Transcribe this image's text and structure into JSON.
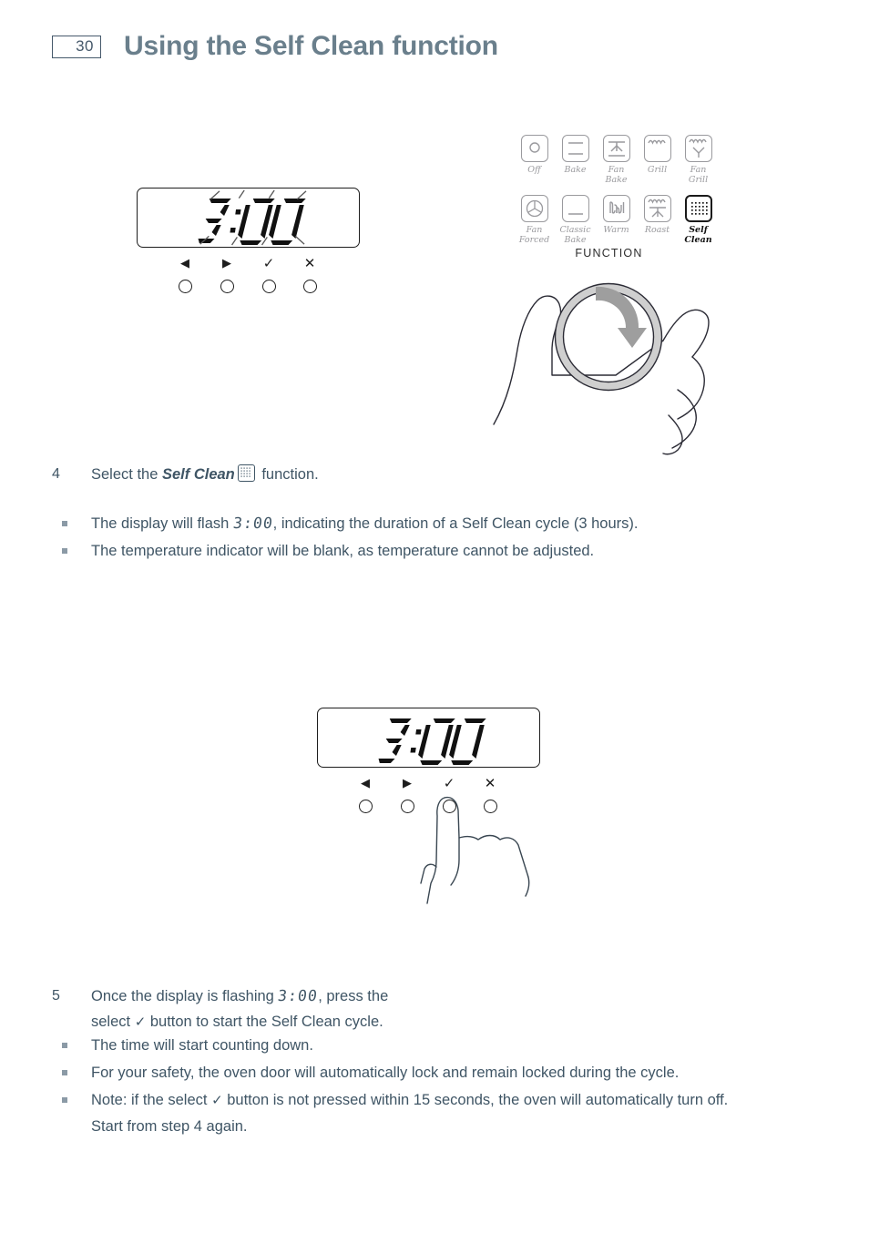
{
  "header": {
    "page_number": "30",
    "title": "Using the Self Clean function"
  },
  "colors": {
    "text": "#3f5565",
    "title": "#6a7f8c",
    "icon_inactive": "#9a9a9e",
    "icon_active": "#111111",
    "arrow_gray": "#9e9e9e",
    "bullet": "#8b9aa6"
  },
  "display_top": {
    "name": "oven-display-flashing",
    "value": "3:00",
    "flashing": true,
    "buttons": [
      {
        "name": "left-arrow-button",
        "glyph": "◀"
      },
      {
        "name": "right-arrow-button",
        "glyph": "▶"
      },
      {
        "name": "select-button",
        "glyph": "✓"
      },
      {
        "name": "cancel-button",
        "glyph": "✕"
      }
    ]
  },
  "display_bottom": {
    "name": "oven-display-steady",
    "value": "3:00",
    "flashing": false,
    "pressed_button": "select-button",
    "buttons": [
      {
        "name": "left-arrow-button",
        "glyph": "◀"
      },
      {
        "name": "right-arrow-button",
        "glyph": "▶"
      },
      {
        "name": "select-button",
        "glyph": "✓"
      },
      {
        "name": "cancel-button",
        "glyph": "✕"
      }
    ]
  },
  "function_dial": {
    "caption": "FUNCTION",
    "selected": "Self Clean",
    "rows": [
      [
        {
          "label": "Off",
          "icon": "circle-icon",
          "selected": false
        },
        {
          "label": "Bake",
          "icon": "bake-icon",
          "selected": false
        },
        {
          "label": "Fan\nBake",
          "label_line1": "Fan",
          "label_line2": "Bake",
          "icon": "fan-bake-icon",
          "selected": false
        },
        {
          "label": "Grill",
          "icon": "grill-icon",
          "selected": false
        },
        {
          "label": "Fan\nGrill",
          "label_line1": "Fan",
          "label_line2": "Grill",
          "icon": "fan-grill-icon",
          "selected": false
        }
      ],
      [
        {
          "label": "Fan\nForced",
          "label_line1": "Fan",
          "label_line2": "Forced",
          "icon": "fan-forced-icon",
          "selected": false
        },
        {
          "label": "Classic\nBake",
          "label_line1": "Classic",
          "label_line2": "Bake",
          "icon": "classic-bake-icon",
          "selected": false
        },
        {
          "label": "Warm",
          "icon": "warm-icon",
          "selected": false
        },
        {
          "label": "Roast",
          "icon": "roast-icon",
          "selected": false
        },
        {
          "label": "Self\nClean",
          "label_line1": "Self",
          "label_line2": "Clean",
          "icon": "self-clean-icon",
          "selected": true
        }
      ]
    ]
  },
  "step4": {
    "number": "4",
    "text_before": "Select the ",
    "emphasis": "Self Clean",
    "text_after": " function.",
    "bullets": [
      {
        "text_before": "The display will flash ",
        "segment": "3:00",
        "text_after": ", indicating the duration of a Self Clean cycle (3 hours)."
      },
      {
        "text_before": "The temperature indicator will be blank, as temperature cannot be adjusted.",
        "segment": "",
        "text_after": ""
      }
    ]
  },
  "step5": {
    "number": "5",
    "line1_before": "Once the display is flashing ",
    "line1_segment": "3:00",
    "line1_after": ", press the",
    "line2_before": "select ",
    "line2_tick": "✓",
    "line2_after": " button to start the Self Clean cycle.",
    "bullets": [
      {
        "text": "The time will start counting down."
      },
      {
        "text": "For your safety, the oven door will automatically lock and remain locked during the cycle."
      },
      {
        "text_before": "Note: if the select ",
        "tick": "✓",
        "text_after": " button is not pressed within 15 seconds, the oven will automatically turn off.",
        "line2": "Start from step 4 again."
      }
    ]
  },
  "illustrations": {
    "hand_knob": "hand-turning-knob-illustration",
    "finger_press": "finger-pressing-button-illustration",
    "rotation_arrow": "clockwise-rotation-arrow"
  }
}
